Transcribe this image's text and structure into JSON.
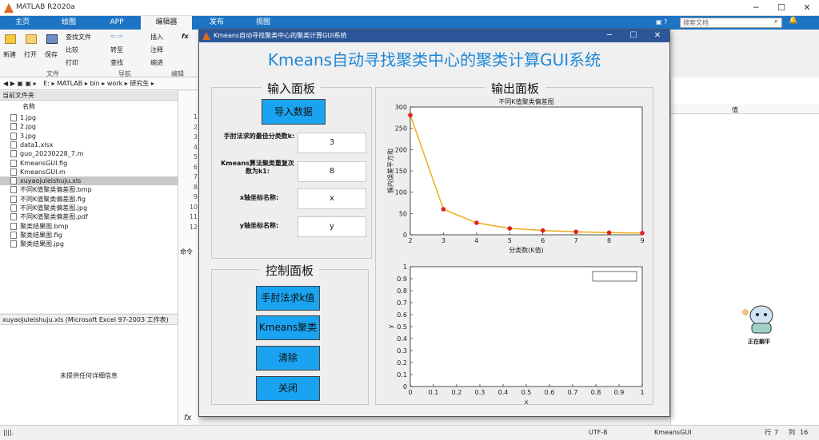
{
  "app": {
    "title": "MATLAB R2020a"
  },
  "ribbon": {
    "tabs": [
      "主页",
      "绘图",
      "APP",
      "编辑器",
      "发布",
      "视图"
    ],
    "active_tab": "编辑器",
    "search_placeholder": "搜索文档",
    "buttons": {
      "new": "新建",
      "open": "打开",
      "save": "保存",
      "find_files": "查找文件",
      "compare": "比较",
      "print": "打印",
      "goto": "转至",
      "find": "查找",
      "insert": "插入",
      "comment": "注释",
      "indent": "缩进"
    },
    "sections": {
      "file": "文件",
      "navigate": "导航",
      "edit": "编辑"
    }
  },
  "path": {
    "segments": [
      "E:",
      "MATLAB",
      "bin",
      "work",
      "研究生"
    ]
  },
  "current_folder": {
    "header": "当前文件夹",
    "column": "名称",
    "files": [
      {
        "name": "1.jpg",
        "selected": false
      },
      {
        "name": "2.jpg",
        "selected": false
      },
      {
        "name": "3.jpg",
        "selected": false
      },
      {
        "name": "data1.xlsx",
        "selected": false
      },
      {
        "name": "guo_20230228_7.m",
        "selected": false
      },
      {
        "name": "KmeansGUI.fig",
        "selected": false
      },
      {
        "name": "KmeansGUI.m",
        "selected": false
      },
      {
        "name": "xuyaojuleishuju.xls",
        "selected": true
      },
      {
        "name": "不同K值聚类偏差图.bmp",
        "selected": false
      },
      {
        "name": "不同K值聚类偏差图.fig",
        "selected": false
      },
      {
        "name": "不同K值聚类偏差图.jpg",
        "selected": false
      },
      {
        "name": "不同K值聚类偏差图.pdf",
        "selected": false
      },
      {
        "name": "聚类结果图.bmp",
        "selected": false
      },
      {
        "name": "聚类结果图.fig",
        "selected": false
      },
      {
        "name": "聚类结果图.jpg",
        "selected": false
      }
    ]
  },
  "details": {
    "header": "xuyaojuleishuju.xls (Microsoft Excel 97-2003 工作表)",
    "empty_text": "未提供任何详细信息"
  },
  "editor": {
    "line_numbers": [
      "1",
      "2",
      "3",
      "4",
      "5",
      "6",
      "7",
      "8",
      "9",
      "10",
      "11",
      "12"
    ],
    "cmd_label": "命令"
  },
  "workspace": {
    "value_col": "值"
  },
  "statusbar": {
    "encoding": "UTF-8",
    "file": "KmeansGUI",
    "row_label": "行",
    "row": "7",
    "col_label": "列",
    "col": "16"
  },
  "fx": "fx",
  "gui": {
    "window_title": "Kmeans自动寻找聚类中心的聚类计算GUI系统",
    "main_title": "Kmeans自动寻找聚类中心的聚类计算GUI系统",
    "input_panel": {
      "title": "输入面板",
      "import_button": "导入数据",
      "fields": [
        {
          "label": "手肘法求的最佳分类数k:",
          "value": "3"
        },
        {
          "label": "Kmeans算法聚类重复次数为k1:",
          "value": "8"
        },
        {
          "label": "x轴坐标名称:",
          "value": "x"
        },
        {
          "label": "y轴坐标名称:",
          "value": "y"
        }
      ]
    },
    "control_panel": {
      "title": "控制面板",
      "buttons": [
        "手肘法求k值",
        "Kmeans聚类",
        "清除",
        "关闭"
      ]
    },
    "output_panel": {
      "title": "输出面板"
    }
  },
  "chart_data": [
    {
      "type": "line",
      "title": "不同K值聚类偏差图",
      "xlabel": "分类数(K值)",
      "ylabel": "簇内误差平方和",
      "x": [
        2,
        3,
        4,
        5,
        6,
        7,
        8,
        9
      ],
      "values": [
        281,
        60,
        28,
        15,
        10,
        7,
        5,
        4
      ],
      "xlim": [
        2,
        9
      ],
      "ylim": [
        0,
        300
      ],
      "xticks": [
        2,
        3,
        4,
        5,
        6,
        7,
        8,
        9
      ],
      "yticks": [
        0,
        50,
        100,
        150,
        200,
        250,
        300
      ],
      "line_color": "#edb120",
      "marker_color": "#e02020",
      "grid": false
    },
    {
      "type": "scatter",
      "title": "",
      "xlabel": "x",
      "ylabel": "y",
      "x": [],
      "values": [],
      "xlim": [
        0,
        1
      ],
      "ylim": [
        0,
        1
      ],
      "xticks": [
        0,
        0.1,
        0.2,
        0.3,
        0.4,
        0.5,
        0.6,
        0.7,
        0.8,
        0.9,
        1
      ],
      "yticks": [
        0,
        0.1,
        0.2,
        0.3,
        0.4,
        0.5,
        0.6,
        0.7,
        0.8,
        0.9,
        1
      ],
      "legend": "top-right",
      "grid": false
    }
  ],
  "mascot": {
    "caption": "正在躺平"
  }
}
